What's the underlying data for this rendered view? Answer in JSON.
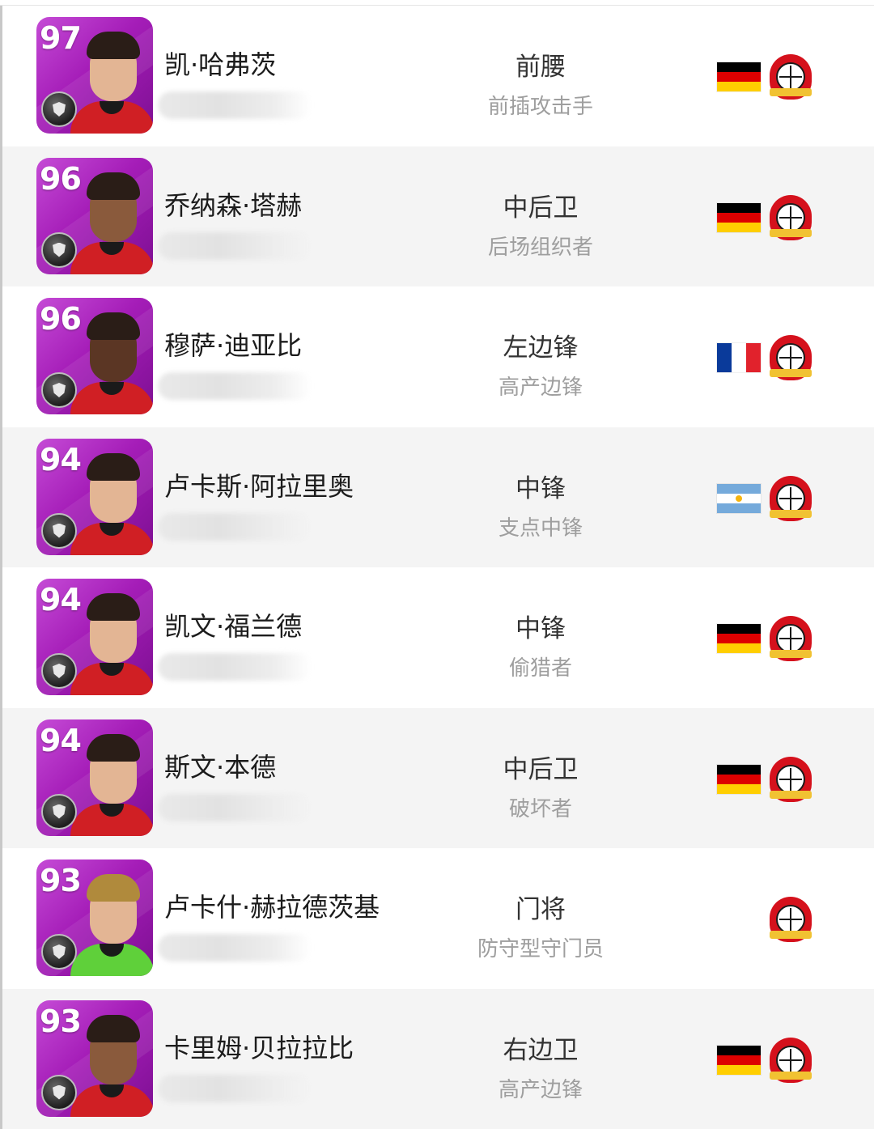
{
  "players": [
    {
      "rating": "97",
      "name": "凯·哈弗茨",
      "position": "前腰",
      "role": "前插攻击手",
      "flag": "de",
      "club": "Bayer 04 Leverkusen"
    },
    {
      "rating": "96",
      "name": "乔纳森·塔赫",
      "position": "中后卫",
      "role": "后场组织者",
      "flag": "de",
      "club": "Bayer 04 Leverkusen"
    },
    {
      "rating": "96",
      "name": "穆萨·迪亚比",
      "position": "左边锋",
      "role": "高产边锋",
      "flag": "fr",
      "club": "Bayer 04 Leverkusen"
    },
    {
      "rating": "94",
      "name": "卢卡斯·阿拉里奥",
      "position": "中锋",
      "role": "支点中锋",
      "flag": "ar",
      "club": "Bayer 04 Leverkusen"
    },
    {
      "rating": "94",
      "name": "凯文·福兰德",
      "position": "中锋",
      "role": "偷猎者",
      "flag": "de",
      "club": "Bayer 04 Leverkusen"
    },
    {
      "rating": "94",
      "name": "斯文·本德",
      "position": "中后卫",
      "role": "破坏者",
      "flag": "de",
      "club": "Bayer 04 Leverkusen"
    },
    {
      "rating": "93",
      "name": "卢卡什·赫拉德茨基",
      "position": "门将",
      "role": "防守型守门员",
      "flag": "",
      "club": "Bayer 04 Leverkusen"
    },
    {
      "rating": "93",
      "name": "卡里姆·贝拉拉比",
      "position": "右边卫",
      "role": "高产边锋",
      "flag": "de",
      "club": "Bayer 04 Leverkusen"
    }
  ]
}
